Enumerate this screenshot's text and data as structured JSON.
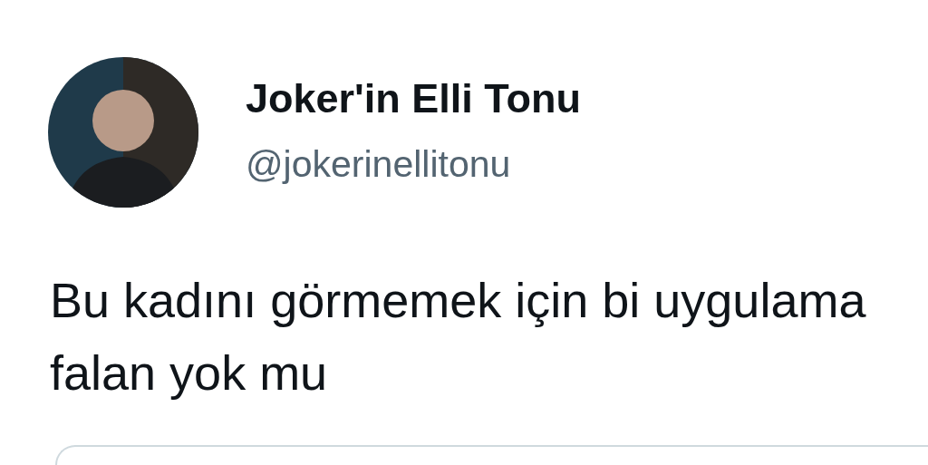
{
  "author": {
    "name": "Joker'in Elli Tonu",
    "handle": "@jokerinellitonu"
  },
  "tweet": {
    "text": "Bu kadını görmemek için bi uygulama falan yok mu"
  }
}
